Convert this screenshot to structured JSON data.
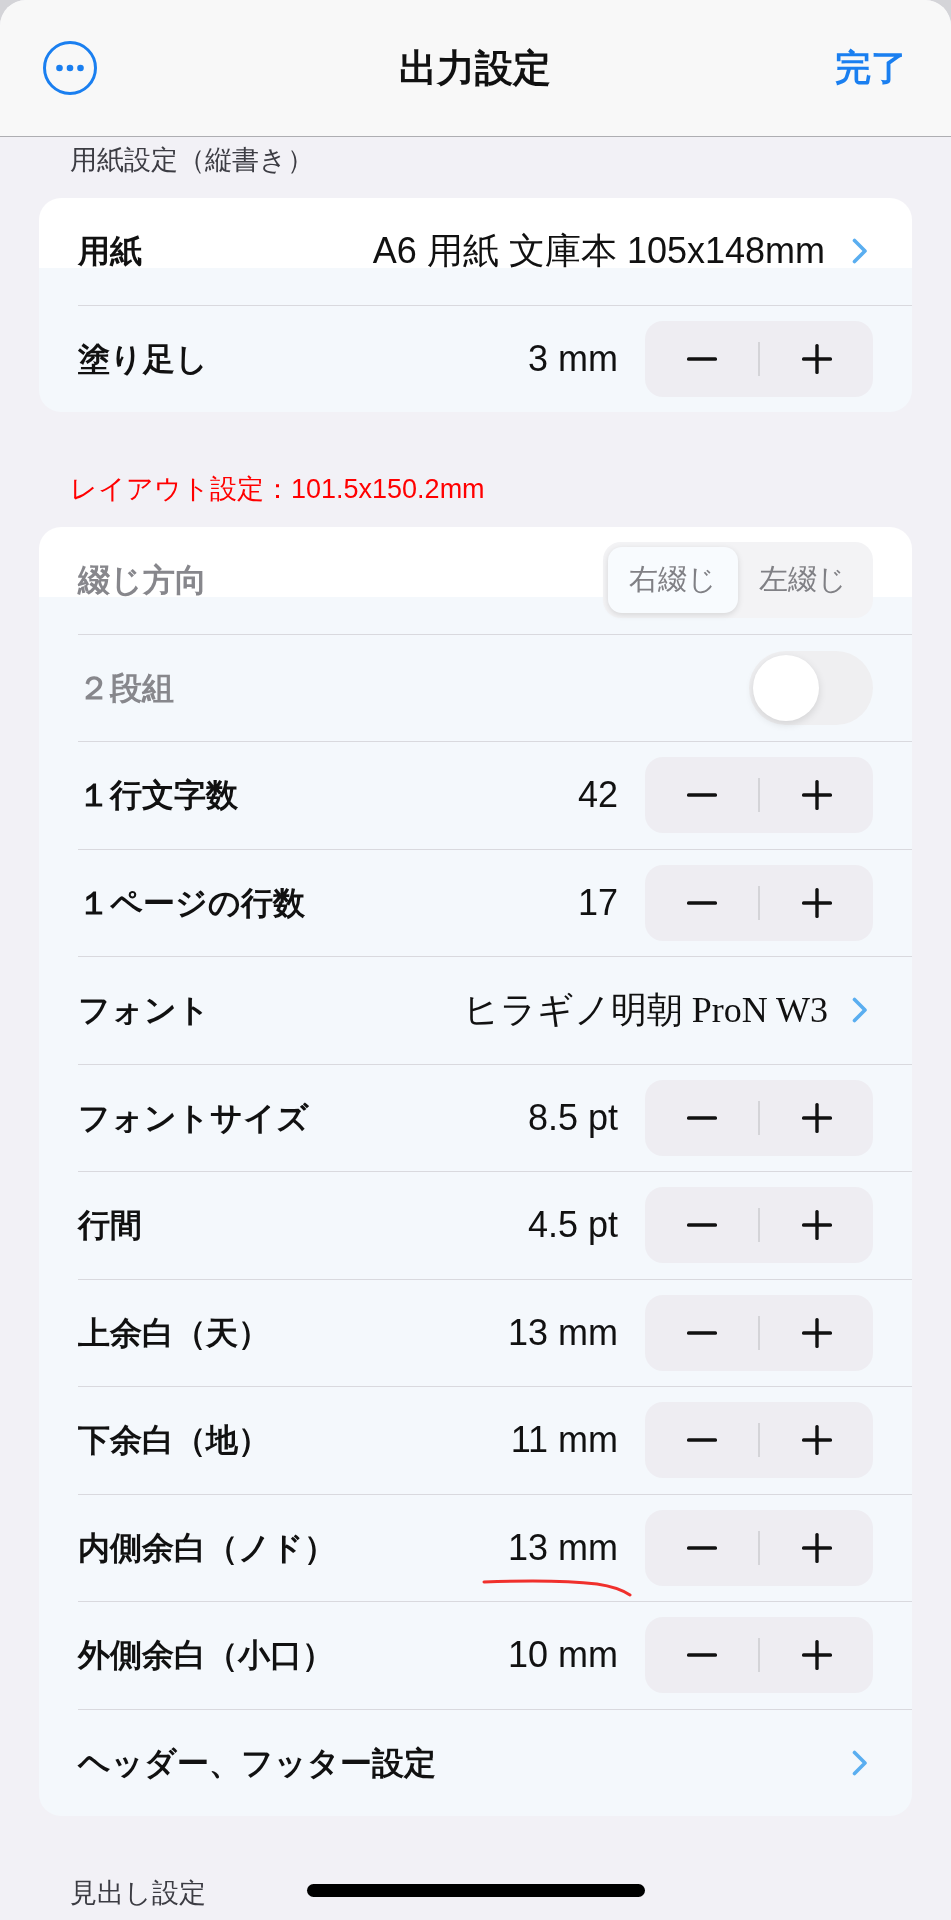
{
  "nav": {
    "title": "出力設定",
    "done": "完了"
  },
  "sections": [
    {
      "header": {
        "text": "用紙設定（縦書き）",
        "color": "#3c3c43"
      },
      "rows": [
        {
          "kind": "link",
          "label": "用紙",
          "value": "A6 用紙 文庫本 105x148mm",
          "disabled": false,
          "marked": false
        },
        {
          "kind": "stepper",
          "label": "塗り足し",
          "value": "3 mm",
          "disabled": false,
          "marked": false
        }
      ]
    },
    {
      "header": {
        "text": "レイアウト設定：101.5x150.2mm",
        "color": "#ff0000"
      },
      "rows": [
        {
          "kind": "segmented",
          "label": "綴じ方向",
          "options": [
            {
              "label": "右綴じ",
              "selected": true
            },
            {
              "label": "左綴じ",
              "selected": false
            }
          ],
          "disabled": true,
          "marked": false
        },
        {
          "kind": "toggle",
          "label": "２段組",
          "on": false,
          "disabled": true,
          "marked": false
        },
        {
          "kind": "stepper",
          "label": "１行文字数",
          "value": "42",
          "disabled": false,
          "marked": false
        },
        {
          "kind": "stepper",
          "label": "１ページの行数",
          "value": "17",
          "disabled": false,
          "marked": false
        },
        {
          "kind": "font",
          "label": "フォント",
          "value": "ヒラギノ明朝 ProN W3",
          "disabled": false,
          "marked": false
        },
        {
          "kind": "stepper",
          "label": "フォントサイズ",
          "value": "8.5 pt",
          "disabled": false,
          "marked": false
        },
        {
          "kind": "stepper",
          "label": "行間",
          "value": "4.5 pt",
          "disabled": false,
          "marked": false
        },
        {
          "kind": "stepper",
          "label": "上余白（天）",
          "value": "13 mm",
          "disabled": false,
          "marked": false
        },
        {
          "kind": "stepper",
          "label": "下余白（地）",
          "value": "11 mm",
          "disabled": false,
          "marked": false
        },
        {
          "kind": "stepper",
          "label": "内側余白（ノド）",
          "value": "13 mm",
          "disabled": false,
          "marked": true
        },
        {
          "kind": "stepper",
          "label": "外側余白（小口）",
          "value": "10 mm",
          "disabled": false,
          "marked": false
        },
        {
          "kind": "link",
          "label": "ヘッダー、フッター設定",
          "disabled": false,
          "marked": false
        }
      ]
    },
    {
      "header": {
        "text": "見出し設定",
        "color": "#3c3c43"
      }
    }
  ]
}
